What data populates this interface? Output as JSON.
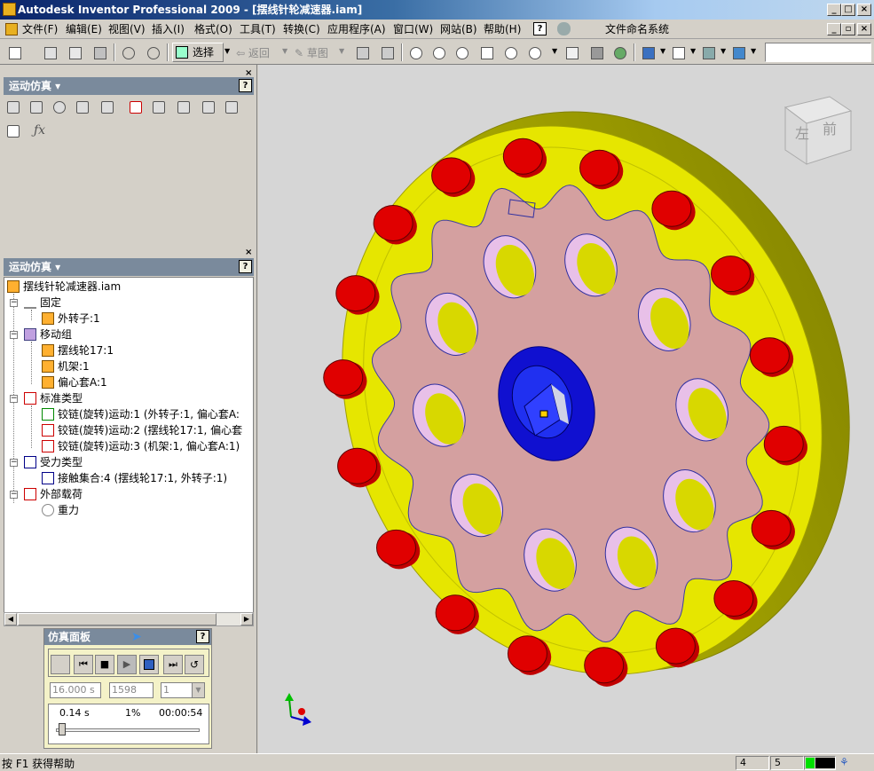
{
  "window": {
    "title": "Autodesk Inventor Professional 2009 - [摆线针轮减速器.iam]",
    "controls": [
      "_",
      "□",
      "×"
    ],
    "doc_controls": [
      "_",
      "▫",
      "×"
    ]
  },
  "menu": {
    "items": [
      "文件(F)",
      "编辑(E)",
      "视图(V)",
      "插入(I)",
      "格式(O)",
      "工具(T)",
      "转换(C)",
      "应用程序(A)",
      "窗口(W)",
      "网站(B)",
      "帮助(H)"
    ],
    "naming_system": "文件命名系统"
  },
  "toolbar": {
    "select_label": "选择",
    "return_label": "返回",
    "sketch_label": "草图"
  },
  "panel_top": {
    "title": "运动仿真 ▾",
    "help": "?"
  },
  "panel_browser": {
    "title": "运动仿真 ▾",
    "help": "?",
    "root": "摆线针轮减速器.iam",
    "nodes": [
      {
        "label": "固定",
        "level": 1
      },
      {
        "label": "外转子:1",
        "level": 2
      },
      {
        "label": "移动组",
        "level": 1
      },
      {
        "label": "摆线轮17:1",
        "level": 2
      },
      {
        "label": "机架:1",
        "level": 2
      },
      {
        "label": "偏心套A:1",
        "level": 2
      },
      {
        "label": "标准类型",
        "level": 1
      },
      {
        "label": "铰链(旋转)运动:1 (外转子:1, 偏心套A:",
        "level": 2
      },
      {
        "label": "铰链(旋转)运动:2 (摆线轮17:1, 偏心套",
        "level": 2
      },
      {
        "label": "铰链(旋转)运动:3 (机架:1, 偏心套A:1)",
        "level": 2
      },
      {
        "label": "受力类型",
        "level": 1
      },
      {
        "label": "接触集合:4 (摆线轮17:1, 外转子:1)",
        "level": 2
      },
      {
        "label": "外部载荷",
        "level": 1
      },
      {
        "label": "重力",
        "level": 2
      }
    ]
  },
  "sim_panel": {
    "title": "仿真面板",
    "help": "?",
    "end_time": "16.000 s",
    "frames": "1598",
    "step": "1",
    "current_time": "0.14 s",
    "percent": "1%",
    "elapsed": "00:00:54",
    "progress": 0.01
  },
  "viewcube": {
    "left": "左",
    "front": "前"
  },
  "status": {
    "help_text": "按 F1 获得帮助",
    "box1": "4",
    "box2": "5"
  },
  "colors": {
    "ring": "#e6e600",
    "pins": "#e00000",
    "disc": "#d4a0a0",
    "hub": "#1010d0"
  }
}
